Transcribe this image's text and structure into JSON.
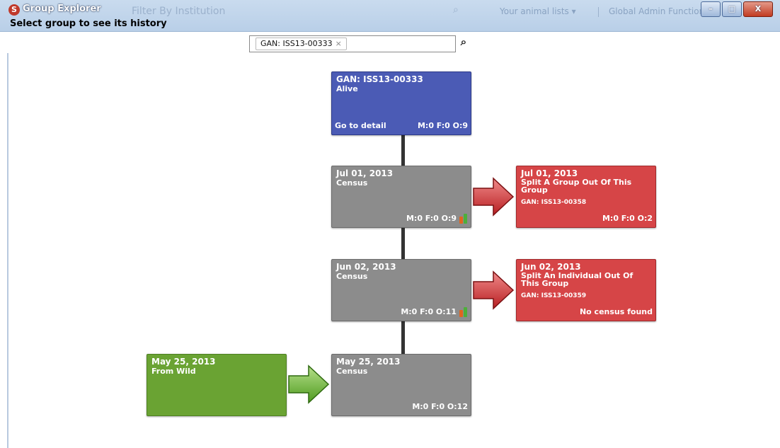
{
  "window": {
    "title": "Group Explorer",
    "ghost_filter": "Filter By Institution",
    "ghost_lists": "Your animal lists ▾",
    "ghost_admin": "Global Admin Functions",
    "minimize": "–",
    "maximize": "□",
    "close": "X"
  },
  "header": {
    "select_label": "Select group to see its history",
    "search_tag": "GAN: ISS13-00333",
    "search_tag_remove": "×",
    "search_icon": "⌕"
  },
  "colors": {
    "current": "#4b5bb5",
    "census": "#8c8c8c",
    "split": "#d64547",
    "origin": "#6aa333"
  },
  "nodes": {
    "current": {
      "line1": "GAN: ISS13-00333",
      "line2": "Alive",
      "detail": "Go to detail",
      "counts": "M:0 F:0 O:9"
    },
    "census1": {
      "line1": "Jul 01, 2013",
      "line2": "Census",
      "counts": "M:0 F:0 O:9"
    },
    "split1": {
      "line1": "Jul 01, 2013",
      "line2": "Split A Group Out Of This Group",
      "line3": "GAN: ISS13-00358",
      "counts": "M:0 F:0 O:2"
    },
    "census2": {
      "line1": "Jun 02, 2013",
      "line2": "Census",
      "counts": "M:0 F:0 O:11"
    },
    "split2": {
      "line1": "Jun 02, 2013",
      "line2": "Split An Individual Out Of This Group",
      "line3": "GAN: ISS13-00359",
      "counts": "No census found"
    },
    "census3": {
      "line1": "May 25, 2013",
      "line2": "Census",
      "counts": "M:0 F:0 O:12"
    },
    "origin": {
      "line1": "May 25, 2013",
      "line2": "From Wild"
    }
  }
}
